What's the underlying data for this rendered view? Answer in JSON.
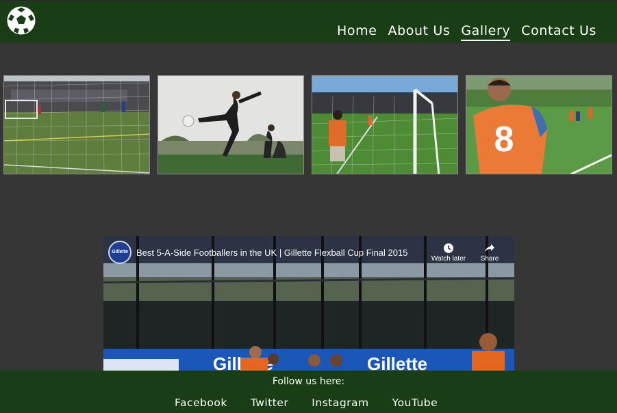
{
  "header": {
    "logo_icon": "soccer-ball-icon",
    "nav": [
      {
        "label": "Home",
        "active": false
      },
      {
        "label": "About Us",
        "active": false
      },
      {
        "label": "Gallery",
        "active": true
      },
      {
        "label": "Contact Us",
        "active": false
      }
    ]
  },
  "gallery": {
    "images": [
      {
        "desc": "football-pitch-goal"
      },
      {
        "desc": "player-volley-kick"
      },
      {
        "desc": "goal-net-players"
      },
      {
        "desc": "player-orange-number-8"
      }
    ],
    "jersey_number": "8"
  },
  "video": {
    "channel": "Gillette",
    "title": "Best 5-A-Side Footballers in the UK | Gillette Flexball Cup Final 2015",
    "watch_later": "Watch later",
    "share": "Share"
  },
  "footer": {
    "follow_text": "Follow us here:",
    "social": [
      "Facebook",
      "Twitter",
      "Instagram",
      "YouTube"
    ]
  }
}
